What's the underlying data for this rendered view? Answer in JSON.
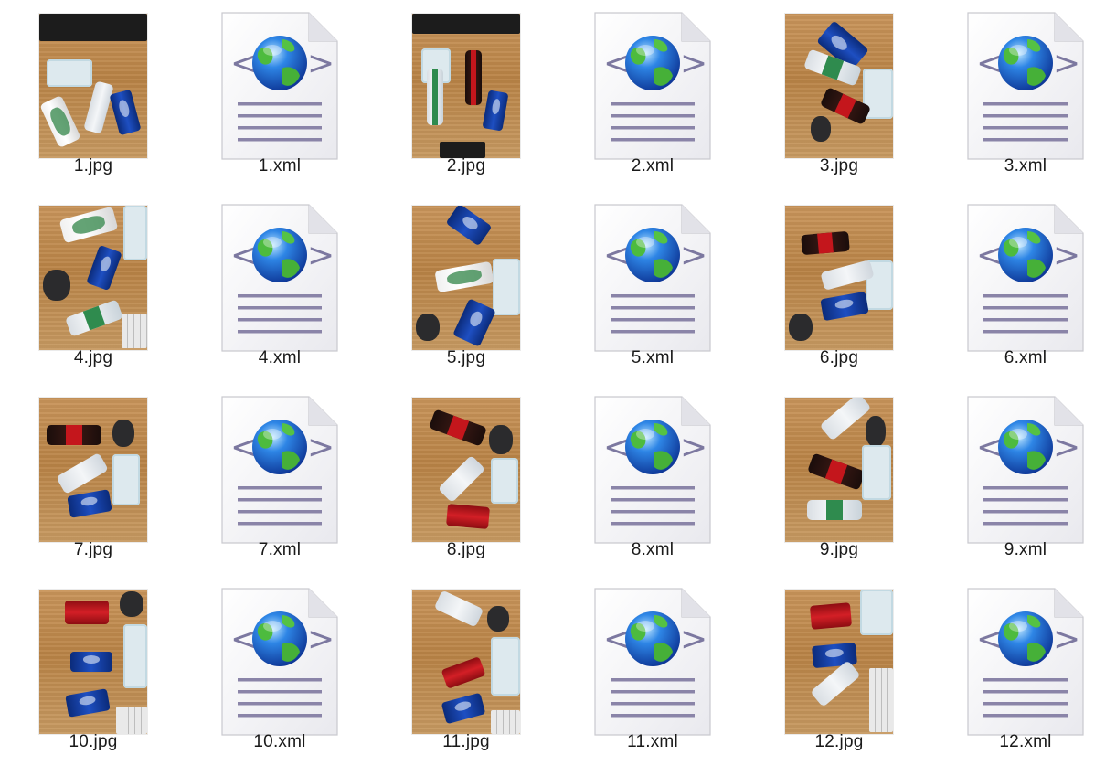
{
  "files": [
    {
      "name": "1.jpg",
      "type": "photo",
      "scene": 1
    },
    {
      "name": "1.xml",
      "type": "xml",
      "icon": "xml-globe-icon"
    },
    {
      "name": "2.jpg",
      "type": "photo",
      "scene": 2
    },
    {
      "name": "2.xml",
      "type": "xml",
      "icon": "xml-globe-icon"
    },
    {
      "name": "3.jpg",
      "type": "photo",
      "scene": 3
    },
    {
      "name": "3.xml",
      "type": "xml",
      "icon": "xml-globe-icon"
    },
    {
      "name": "4.jpg",
      "type": "photo",
      "scene": 4
    },
    {
      "name": "4.xml",
      "type": "xml",
      "icon": "xml-globe-icon"
    },
    {
      "name": "5.jpg",
      "type": "photo",
      "scene": 5
    },
    {
      "name": "5.xml",
      "type": "xml",
      "icon": "xml-globe-icon"
    },
    {
      "name": "6.jpg",
      "type": "photo",
      "scene": 6
    },
    {
      "name": "6.xml",
      "type": "xml",
      "icon": "xml-globe-icon"
    },
    {
      "name": "7.jpg",
      "type": "photo",
      "scene": 7
    },
    {
      "name": "7.xml",
      "type": "xml",
      "icon": "xml-globe-icon"
    },
    {
      "name": "8.jpg",
      "type": "photo",
      "scene": 8
    },
    {
      "name": "8.xml",
      "type": "xml",
      "icon": "xml-globe-icon"
    },
    {
      "name": "9.jpg",
      "type": "photo",
      "scene": 9
    },
    {
      "name": "9.xml",
      "type": "xml",
      "icon": "xml-globe-icon"
    },
    {
      "name": "10.jpg",
      "type": "photo",
      "scene": 10
    },
    {
      "name": "10.xml",
      "type": "xml",
      "icon": "xml-globe-icon"
    },
    {
      "name": "11.jpg",
      "type": "photo",
      "scene": 11
    },
    {
      "name": "11.xml",
      "type": "xml",
      "icon": "xml-globe-icon"
    },
    {
      "name": "12.jpg",
      "type": "photo",
      "scene": 12
    },
    {
      "name": "12.xml",
      "type": "xml",
      "icon": "xml-globe-icon"
    }
  ],
  "colors": {
    "background": "#ffffff",
    "label_text": "#1a1a1a",
    "globe_blue": "#1f5fd1",
    "globe_green": "#3fb23a",
    "doc_lines": "#8a84a8"
  }
}
